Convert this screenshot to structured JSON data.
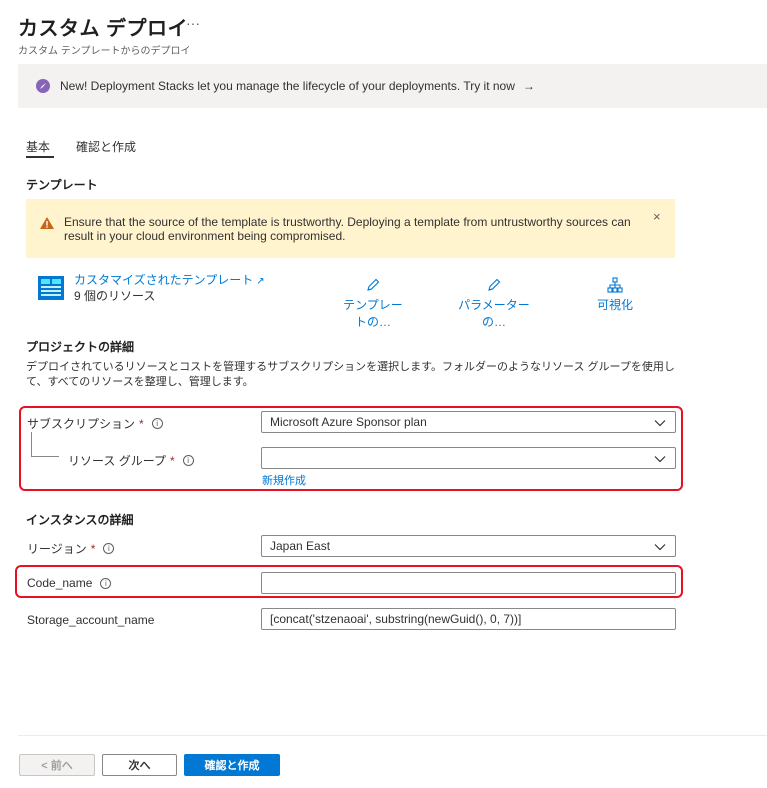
{
  "header": {
    "title": "カスタム デプロイ",
    "more": "···",
    "subtitle": "カスタム テンプレートからのデプロイ"
  },
  "banner": {
    "text": "New! Deployment Stacks let you manage the lifecycle of your deployments. Try it now",
    "arrow": "→",
    "icon": "rocket-icon"
  },
  "tabs": [
    {
      "label": "基本",
      "active": true
    },
    {
      "label": "確認と作成",
      "active": false
    }
  ],
  "template_section": {
    "heading": "テンプレート",
    "warning": {
      "icon": "warning-icon",
      "text": "Ensure that the source of the template is trustworthy. Deploying a template from untrustworthy sources can result in your cloud environment being compromised.",
      "close": "×"
    },
    "template_link": "カスタマイズされたテンプレート",
    "external_icon": "↗",
    "resource_count": "9 個のリソース",
    "actions": [
      {
        "label": "テンプレートの…",
        "icon": "pencil-icon"
      },
      {
        "label": "パラメーターの…",
        "icon": "pencil-icon"
      },
      {
        "label": "可視化",
        "icon": "hierarchy-icon"
      }
    ]
  },
  "project_section": {
    "heading": "プロジェクトの詳細",
    "description": "デプロイされているリソースとコストを管理するサブスクリプションを選択します。フォルダーのようなリソース グループを使用して、すべてのリソースを整理し、管理します。",
    "subscription_label": "サブスクリプション",
    "subscription_value": "Microsoft Azure Sponsor plan",
    "resource_group_label": "リソース グループ",
    "resource_group_value": "",
    "create_new": "新規作成",
    "required_mark": "*",
    "info_mark": "i"
  },
  "instance_section": {
    "heading": "インスタンスの詳細",
    "region_label": "リージョン",
    "region_value": "Japan East",
    "code_name_label": "Code_name",
    "code_name_value": "",
    "storage_label": "Storage_account_name",
    "storage_value": "[concat('stzenaoai', substring(newGuid(), 0, 7))]"
  },
  "footer": {
    "prev": "< 前へ",
    "next": "次へ",
    "review": "確認と作成"
  },
  "colors": {
    "accent": "#0078d4",
    "warning_bg": "#fff4ce",
    "highlight_box": "#e81123",
    "required": "#a4262c"
  }
}
